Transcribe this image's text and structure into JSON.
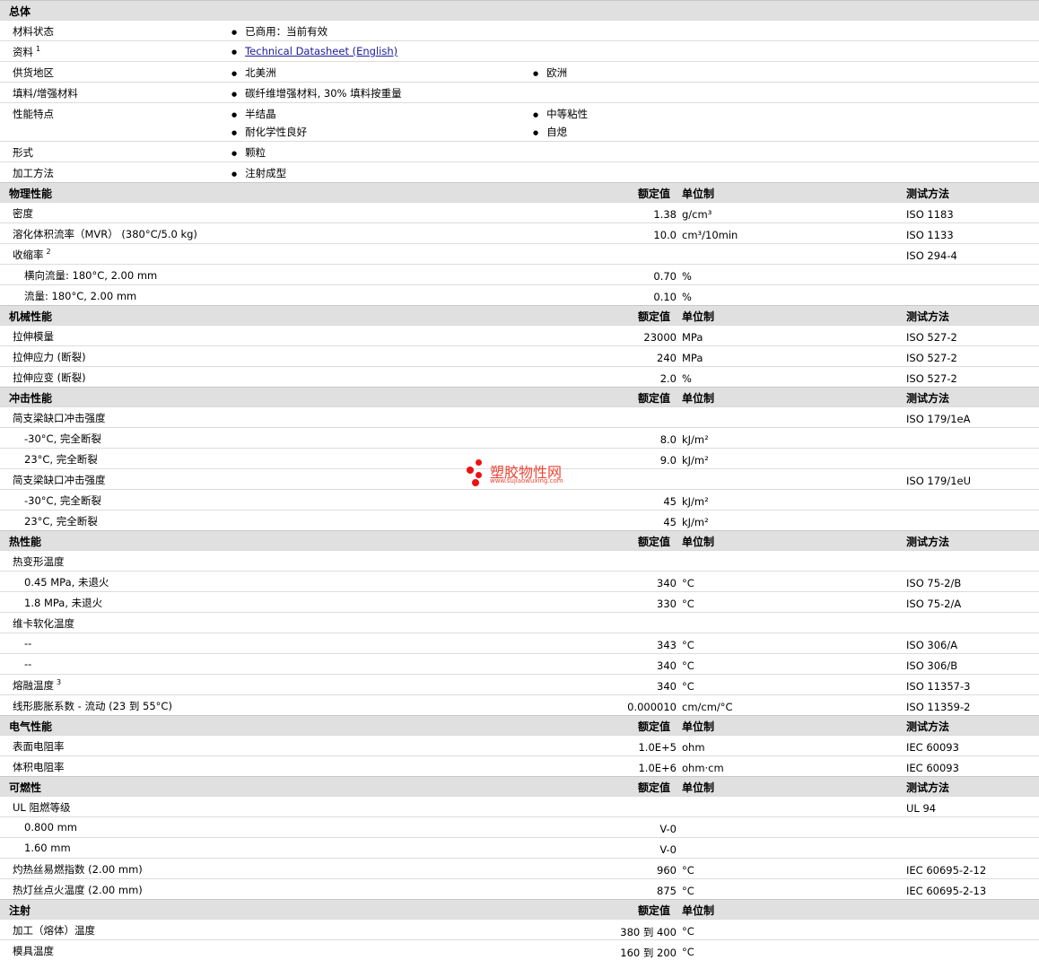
{
  "sections": [
    {
      "title": "总体",
      "heads": null,
      "rows": [
        {
          "kind": "bullets",
          "label": "材料状态",
          "items": [
            "已商用：当前有效"
          ]
        },
        {
          "kind": "bullets",
          "label": "资料",
          "sup": "1",
          "items": [
            "Technical Datasheet (English)"
          ],
          "link": true
        },
        {
          "kind": "bullets",
          "label": "供货地区",
          "items": [
            "北美洲",
            "欧洲"
          ]
        },
        {
          "kind": "bullets",
          "label": "填料/增强材料",
          "items": [
            "碳纤维增强材料, 30% 填料按重量"
          ]
        },
        {
          "kind": "bullets",
          "label": "性能特点",
          "items": [
            "半结晶",
            "中等粘性",
            "耐化学性良好",
            "自熄"
          ]
        },
        {
          "kind": "bullets",
          "label": "形式",
          "items": [
            "颗粒"
          ]
        },
        {
          "kind": "bullets",
          "label": "加工方法",
          "items": [
            "注射成型"
          ]
        }
      ]
    },
    {
      "title": "物理性能",
      "heads": [
        "额定值",
        "单位制",
        "测试方法"
      ],
      "rows": [
        {
          "label": "密度",
          "value": "1.38",
          "unit": "g/cm³",
          "test": "ISO 1183"
        },
        {
          "label": "溶化体积流率（MVR） (380°C/5.0 kg)",
          "value": "10.0",
          "unit": "cm³/10min",
          "test": "ISO 1133"
        },
        {
          "label": "收缩率",
          "sup": "2",
          "value": "",
          "unit": "",
          "test": "ISO 294-4"
        },
        {
          "label": "横向流量: 180°C, 2.00 mm",
          "indent": true,
          "value": "0.70",
          "unit": "%",
          "test": ""
        },
        {
          "label": "流量: 180°C, 2.00 mm",
          "indent": true,
          "value": "0.10",
          "unit": "%",
          "test": ""
        }
      ]
    },
    {
      "title": "机械性能",
      "heads": [
        "额定值",
        "单位制",
        "测试方法"
      ],
      "rows": [
        {
          "label": "拉伸模量",
          "value": "23000",
          "unit": "MPa",
          "test": "ISO 527-2"
        },
        {
          "label": "拉伸应力 (断裂)",
          "value": "240",
          "unit": "MPa",
          "test": "ISO 527-2"
        },
        {
          "label": "拉伸应变 (断裂)",
          "value": "2.0",
          "unit": "%",
          "test": "ISO 527-2"
        }
      ]
    },
    {
      "title": "冲击性能",
      "heads": [
        "额定值",
        "单位制",
        "测试方法"
      ],
      "rows": [
        {
          "label": "简支梁缺口冲击强度",
          "value": "",
          "unit": "",
          "test": "ISO 179/1eA"
        },
        {
          "label": "-30°C, 完全断裂",
          "indent": true,
          "value": "8.0",
          "unit": "kJ/m²",
          "test": ""
        },
        {
          "label": "23°C, 完全断裂",
          "indent": true,
          "value": "9.0",
          "unit": "kJ/m²",
          "test": ""
        },
        {
          "label": "简支梁缺口冲击强度",
          "value": "",
          "unit": "",
          "test": "ISO 179/1eU"
        },
        {
          "label": "-30°C, 完全断裂",
          "indent": true,
          "value": "45",
          "unit": "kJ/m²",
          "test": ""
        },
        {
          "label": "23°C, 完全断裂",
          "indent": true,
          "value": "45",
          "unit": "kJ/m²",
          "test": ""
        }
      ]
    },
    {
      "title": "热性能",
      "heads": [
        "额定值",
        "单位制",
        "测试方法"
      ],
      "rows": [
        {
          "label": "热变形温度",
          "value": "",
          "unit": "",
          "test": ""
        },
        {
          "label": "0.45 MPa, 未退火",
          "indent": true,
          "value": "340",
          "unit": "°C",
          "test": "ISO 75-2/B"
        },
        {
          "label": "1.8 MPa, 未退火",
          "indent": true,
          "value": "330",
          "unit": "°C",
          "test": "ISO 75-2/A"
        },
        {
          "label": "维卡软化温度",
          "value": "",
          "unit": "",
          "test": ""
        },
        {
          "label": "--",
          "indent": true,
          "value": "343",
          "unit": "°C",
          "test": "ISO 306/A"
        },
        {
          "label": "--",
          "indent": true,
          "value": "340",
          "unit": "°C",
          "test": "ISO 306/B"
        },
        {
          "label": "熔融温度",
          "sup": "3",
          "value": "340",
          "unit": "°C",
          "test": "ISO 11357-3"
        },
        {
          "label": "线形膨胀系数 - 流动 (23 到 55°C)",
          "value": "0.000010",
          "unit": "cm/cm/°C",
          "test": "ISO 11359-2"
        }
      ]
    },
    {
      "title": "电气性能",
      "heads": [
        "额定值",
        "单位制",
        "测试方法"
      ],
      "rows": [
        {
          "label": "表面电阻率",
          "value": "1.0E+5",
          "unit": "ohm",
          "test": "IEC 60093"
        },
        {
          "label": "体积电阻率",
          "value": "1.0E+6",
          "unit": "ohm·cm",
          "test": "IEC 60093"
        }
      ]
    },
    {
      "title": "可燃性",
      "heads": [
        "额定值",
        "单位制",
        "测试方法"
      ],
      "rows": [
        {
          "label": "UL 阻燃等级",
          "value": "",
          "unit": "",
          "test": "UL 94"
        },
        {
          "label": "0.800 mm",
          "indent": true,
          "value": "V-0",
          "unit": "",
          "test": ""
        },
        {
          "label": "1.60 mm",
          "indent": true,
          "value": "V-0",
          "unit": "",
          "test": ""
        },
        {
          "label": "灼热丝易燃指数 (2.00 mm)",
          "value": "960",
          "unit": "°C",
          "test": "IEC 60695-2-12"
        },
        {
          "label": "热灯丝点火温度 (2.00 mm)",
          "value": "875",
          "unit": "°C",
          "test": "IEC 60695-2-13"
        }
      ]
    },
    {
      "title": "注射",
      "heads": [
        "额定值",
        "单位制",
        ""
      ],
      "rows": [
        {
          "label": "加工（熔体）温度",
          "value": "380 到  400",
          "unit": "°C",
          "test": ""
        },
        {
          "label": "模具温度",
          "value": "160 到  200",
          "unit": "°C",
          "test": ""
        }
      ]
    }
  ],
  "watermark": {
    "text": "塑胶物性网",
    "url": "www.sujiaowuxing.com"
  }
}
